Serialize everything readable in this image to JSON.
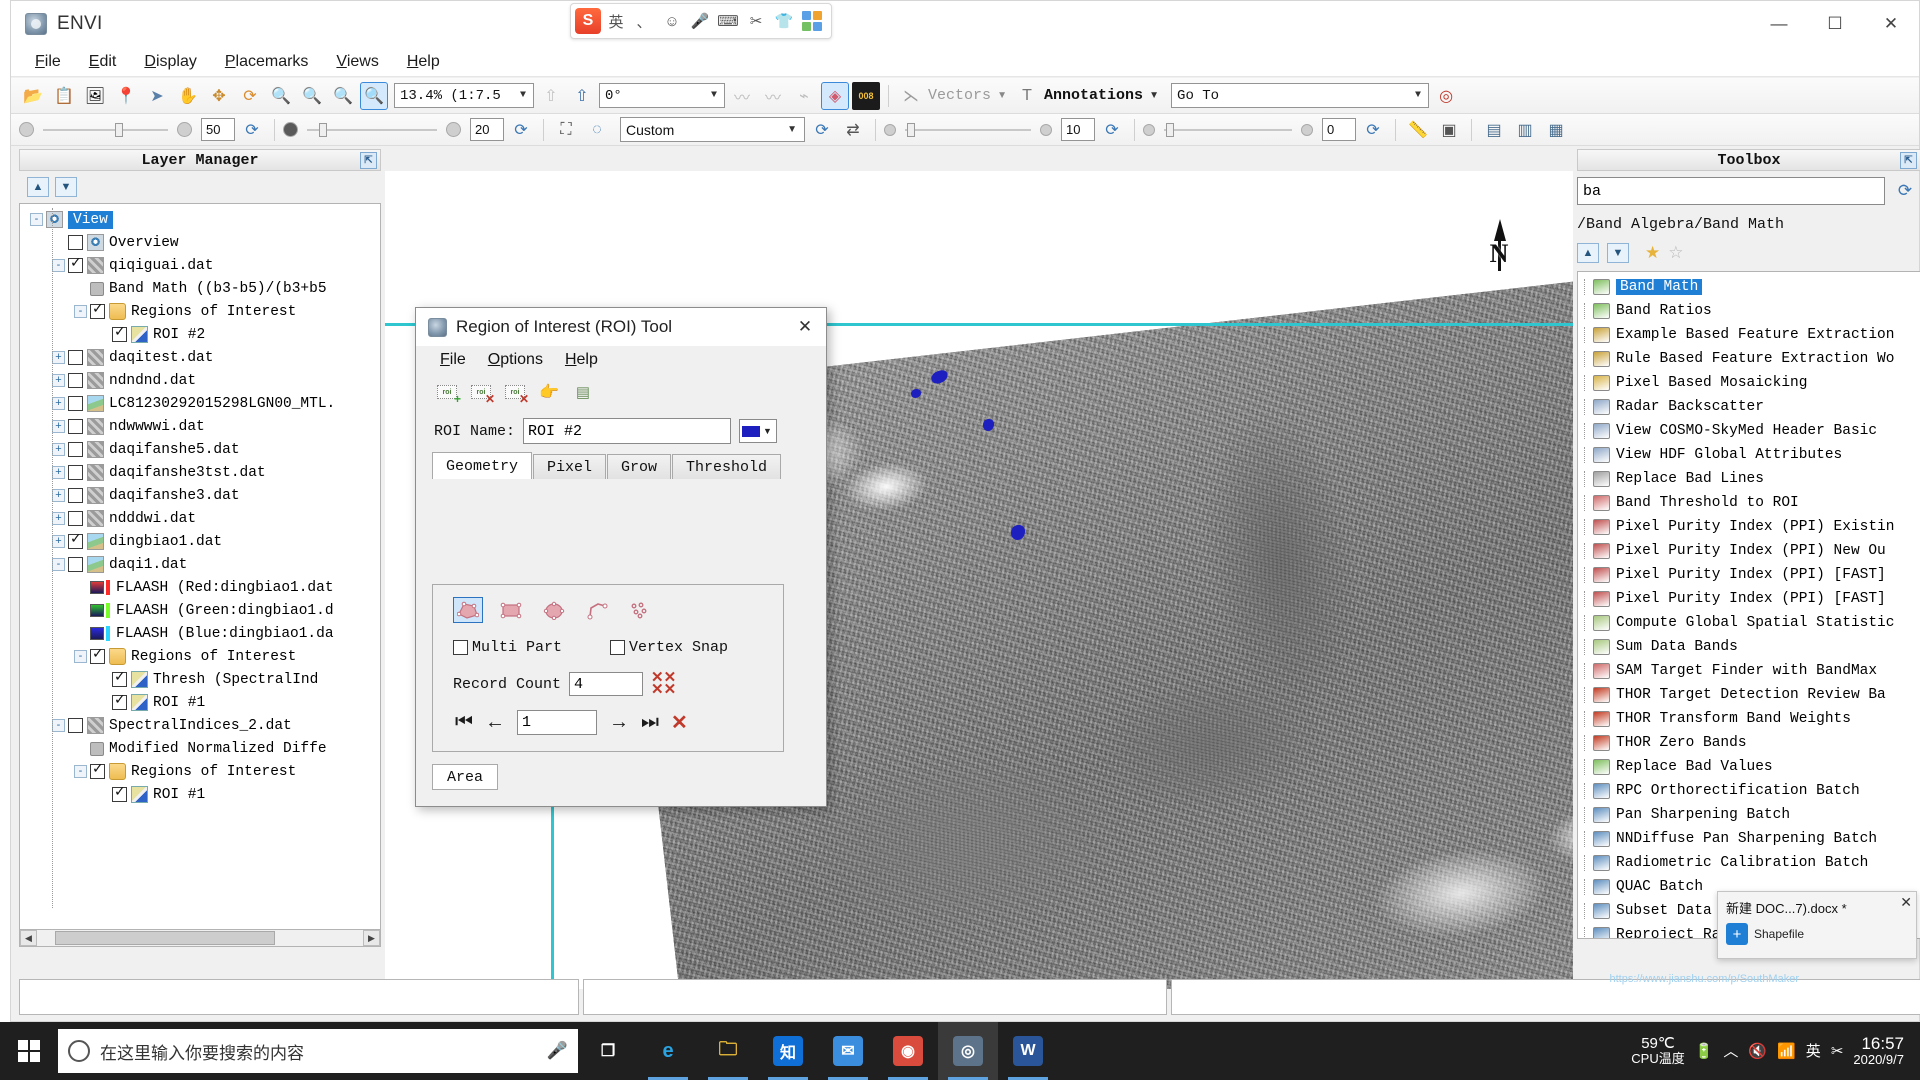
{
  "app": {
    "title": "ENVI",
    "icon": "envi-logo-icon",
    "window_controls": {
      "minimize": "—",
      "maximize": "☐",
      "close": "✕"
    }
  },
  "ime": {
    "logo": "S",
    "lang": "英",
    "items": [
      "、",
      "☺",
      "🎤",
      "⌨",
      "✂",
      "👕"
    ]
  },
  "menubar": [
    {
      "label": "File",
      "mnemonic": "F"
    },
    {
      "label": "Edit",
      "mnemonic": "E"
    },
    {
      "label": "Display",
      "mnemonic": "D"
    },
    {
      "label": "Placemarks",
      "mnemonic": "P"
    },
    {
      "label": "Views",
      "mnemonic": "V"
    },
    {
      "label": "Help",
      "mnemonic": "H"
    }
  ],
  "toolbar1": {
    "buttons": [
      {
        "name": "open-file-icon",
        "glyph": "📂"
      },
      {
        "name": "clipboard-icon",
        "glyph": "📋"
      },
      {
        "name": "crop-image-icon",
        "glyph": "🖼"
      },
      {
        "name": "placemark-pin-icon",
        "glyph": "📍"
      },
      {
        "name": "select-arrow-icon",
        "glyph": "➤"
      },
      {
        "name": "pan-hand-icon",
        "glyph": "✋"
      },
      {
        "name": "fit-to-window-icon",
        "glyph": "✥"
      },
      {
        "name": "rotate-icon",
        "glyph": "⟳"
      },
      {
        "name": "zoom-to-extent-icon",
        "glyph": "🔍"
      },
      {
        "name": "zoom-in-icon",
        "glyph": "🔍"
      },
      {
        "name": "zoom-out-icon",
        "glyph": "🔍"
      },
      {
        "name": "zoom-select-icon",
        "glyph": "🔍"
      }
    ],
    "zoom_value": "13.4% (1:7.5",
    "rotation_value": "0°",
    "go_to_placeholder": "Go To",
    "vectors_label": "Vectors",
    "annotations_label": "Annotations",
    "crosshair_label": "crosshair-icon",
    "roi_tool_label": "roi-tool-icon",
    "pixel_locator_label": "008"
  },
  "toolbar2": {
    "brightness_value": "50",
    "contrast_value": "20",
    "stretch_value": "Custom",
    "sharpen_value": "10",
    "transparency_value": "0"
  },
  "layer_manager": {
    "title": "Layer Manager",
    "pin": "⇱",
    "move_up": "▲",
    "move_down": "▼",
    "tree": [
      {
        "indent": 0,
        "expander": "-",
        "check": null,
        "icon": "eye",
        "label": "View",
        "selected": true
      },
      {
        "indent": 1,
        "expander": "",
        "check": false,
        "icon": "eye",
        "label": "Overview"
      },
      {
        "indent": 1,
        "expander": "-",
        "check": true,
        "icon": "raster",
        "label": "qiqiguai.dat"
      },
      {
        "indent": 2,
        "expander": "",
        "check": null,
        "icon": "band",
        "label": "Band Math ((b3-b5)/(b3+b5"
      },
      {
        "indent": 2,
        "expander": "-",
        "check": true,
        "icon": "folder",
        "label": "Regions of Interest"
      },
      {
        "indent": 3,
        "expander": "",
        "check": true,
        "icon": "roi",
        "label": "ROI #2"
      },
      {
        "indent": 1,
        "expander": "+",
        "check": false,
        "icon": "raster",
        "label": "daqitest.dat"
      },
      {
        "indent": 1,
        "expander": "+",
        "check": false,
        "icon": "raster",
        "label": "ndndnd.dat"
      },
      {
        "indent": 1,
        "expander": "+",
        "check": false,
        "icon": "rgb",
        "label": "LC81230292015298LGN00_MTL."
      },
      {
        "indent": 1,
        "expander": "+",
        "check": false,
        "icon": "raster",
        "label": "ndwwwwi.dat"
      },
      {
        "indent": 1,
        "expander": "+",
        "check": false,
        "icon": "raster",
        "label": "daqifanshe5.dat"
      },
      {
        "indent": 1,
        "expander": "+",
        "check": false,
        "icon": "raster",
        "label": "daqifanshe3tst.dat"
      },
      {
        "indent": 1,
        "expander": "+",
        "check": false,
        "icon": "raster",
        "label": "daqifanshe3.dat"
      },
      {
        "indent": 1,
        "expander": "+",
        "check": false,
        "icon": "raster",
        "label": "ndddwi.dat"
      },
      {
        "indent": 1,
        "expander": "+",
        "check": true,
        "icon": "rgb",
        "label": "dingbiao1.dat"
      },
      {
        "indent": 1,
        "expander": "-",
        "check": false,
        "icon": "rgb",
        "label": "daqi1.dat"
      },
      {
        "indent": 2,
        "expander": "",
        "check": null,
        "icon": "swatch-red",
        "label": "FLAASH (Red:dingbiao1.dat"
      },
      {
        "indent": 2,
        "expander": "",
        "check": null,
        "icon": "swatch-green",
        "label": "FLAASH (Green:dingbiao1.d"
      },
      {
        "indent": 2,
        "expander": "",
        "check": null,
        "icon": "swatch-blue",
        "label": "FLAASH (Blue:dingbiao1.da"
      },
      {
        "indent": 2,
        "expander": "-",
        "check": true,
        "icon": "folder",
        "label": "Regions of Interest"
      },
      {
        "indent": 3,
        "expander": "",
        "check": true,
        "icon": "roi",
        "label": "Thresh (SpectralInd"
      },
      {
        "indent": 3,
        "expander": "",
        "check": true,
        "icon": "roi",
        "label": "ROI #1"
      },
      {
        "indent": 1,
        "expander": "-",
        "check": false,
        "icon": "raster",
        "label": "SpectralIndices_2.dat"
      },
      {
        "indent": 2,
        "expander": "",
        "check": null,
        "icon": "band",
        "label": "Modified Normalized Diffe"
      },
      {
        "indent": 2,
        "expander": "-",
        "check": true,
        "icon": "folder",
        "label": "Regions of Interest"
      },
      {
        "indent": 3,
        "expander": "",
        "check": true,
        "icon": "roi",
        "label": "ROI #1"
      }
    ]
  },
  "roi_dialog": {
    "title": "Region of Interest (ROI) Tool",
    "icon": "envi-logo-icon",
    "close": "✕",
    "menus": [
      {
        "label": "File",
        "mnemonic": "F"
      },
      {
        "label": "Options",
        "mnemonic": "O"
      },
      {
        "label": "Help",
        "mnemonic": "H"
      }
    ],
    "toolbar": [
      {
        "name": "new-roi-icon",
        "badge": "+",
        "badge_color": "#2fa62f"
      },
      {
        "name": "delete-roi-icon",
        "badge": "✕",
        "badge_color": "#c0392b"
      },
      {
        "name": "delete-all-roi-icon",
        "badge": "✕",
        "badge_color": "#c0392b"
      },
      {
        "name": "select-roi-hand-icon",
        "badge": "",
        "badge_color": ""
      },
      {
        "name": "roi-statistics-icon",
        "badge": "",
        "badge_color": ""
      }
    ],
    "roi_name_label": "ROI Name:",
    "roi_name_value": "ROI #2",
    "roi_color": "#1d1fbf",
    "tabs": [
      {
        "label": "Geometry",
        "active": true
      },
      {
        "label": "Pixel",
        "active": false
      },
      {
        "label": "Grow",
        "active": false
      },
      {
        "label": "Threshold",
        "active": false
      }
    ],
    "geometry_tools": [
      {
        "name": "polygon-roi-icon",
        "selected": true
      },
      {
        "name": "rectangle-roi-icon",
        "selected": false
      },
      {
        "name": "ellipse-roi-icon",
        "selected": false
      },
      {
        "name": "polyline-roi-icon",
        "selected": false
      },
      {
        "name": "point-roi-icon",
        "selected": false
      }
    ],
    "multi_part_label": "Multi Part",
    "multi_part_checked": false,
    "vertex_snap_label": "Vertex Snap",
    "vertex_snap_checked": false,
    "record_count_label": "Record Count",
    "record_count_value": "4",
    "delete-record-icon": "✂",
    "nav": {
      "first": "⏮",
      "prev": "←",
      "value": "1",
      "next": "→",
      "last": "⏭",
      "delete": "✕"
    },
    "area_tab": "Area"
  },
  "toolbox": {
    "title": "Toolbox",
    "pin": "⇱",
    "search_value": "ba",
    "refresh": "⟳",
    "path": "/Band Algebra/Band Math",
    "nav_up": "▲",
    "nav_down": "▼",
    "star_filled": "★",
    "star_empty": "☆",
    "items": [
      {
        "label": "Band Math",
        "selected": true,
        "icon": "#7fbf5f"
      },
      {
        "label": "Band Ratios",
        "selected": false,
        "icon": "#7fbf5f"
      },
      {
        "label": "Example Based Feature Extraction",
        "selected": false,
        "icon": "#c9a23a"
      },
      {
        "label": "Rule Based Feature Extraction Wo",
        "selected": false,
        "icon": "#c9a23a"
      },
      {
        "label": "Pixel Based Mosaicking",
        "selected": false,
        "icon": "#d8b44a"
      },
      {
        "label": "Radar Backscatter",
        "selected": false,
        "icon": "#8fa8c8"
      },
      {
        "label": "View COSMO-SkyMed Header Basic",
        "selected": false,
        "icon": "#8fa8c8"
      },
      {
        "label": "View HDF Global Attributes",
        "selected": false,
        "icon": "#8fa8c8"
      },
      {
        "label": "Replace Bad Lines",
        "selected": false,
        "icon": "#a0a0a0"
      },
      {
        "label": "Band Threshold to ROI",
        "selected": false,
        "icon": "#d06a6a"
      },
      {
        "label": "Pixel Purity Index (PPI) Existin",
        "selected": false,
        "icon": "#c05050"
      },
      {
        "label": "Pixel Purity Index (PPI) New Ou",
        "selected": false,
        "icon": "#c05050"
      },
      {
        "label": "Pixel Purity Index (PPI) [FAST]",
        "selected": false,
        "icon": "#c05050"
      },
      {
        "label": "Pixel Purity Index (PPI) [FAST]",
        "selected": false,
        "icon": "#c05050"
      },
      {
        "label": "Compute Global Spatial Statistic",
        "selected": false,
        "icon": "#a8c87f"
      },
      {
        "label": "Sum Data Bands",
        "selected": false,
        "icon": "#a8c87f"
      },
      {
        "label": "SAM Target Finder with BandMax",
        "selected": false,
        "icon": "#d06a6a"
      },
      {
        "label": "THOR Target Detection Review Ba",
        "selected": false,
        "icon": "#c23b22"
      },
      {
        "label": "THOR Transform Band Weights",
        "selected": false,
        "icon": "#c23b22"
      },
      {
        "label": "THOR Zero Bands",
        "selected": false,
        "icon": "#c23b22"
      },
      {
        "label": "Replace Bad Values",
        "selected": false,
        "icon": "#7fbf5f"
      },
      {
        "label": "RPC Orthorectification Batch",
        "selected": false,
        "icon": "#5f8fbf"
      },
      {
        "label": "Pan Sharpening Batch",
        "selected": false,
        "icon": "#5f8fbf"
      },
      {
        "label": "NNDiffuse Pan Sharpening Batch",
        "selected": false,
        "icon": "#5f8fbf"
      },
      {
        "label": "Radiometric Calibration Batch",
        "selected": false,
        "icon": "#5f8fbf"
      },
      {
        "label": "QUAC Batch",
        "selected": false,
        "icon": "#5f8fbf"
      },
      {
        "label": "Subset Data from ROIs Batch",
        "selected": false,
        "icon": "#5f8fbf"
      },
      {
        "label": "Reproject Raster Batch",
        "selected": false,
        "icon": "#5f8fbf"
      }
    ]
  },
  "toast": {
    "filename": "新建 DOC...7).docx *",
    "action_label": "Shapefile",
    "close": "✕"
  },
  "taskbar": {
    "search_placeholder": "在这里输入你要搜索的内容",
    "mic_icon": "🎤",
    "items": [
      {
        "name": "task-view-icon",
        "glyph": "❐",
        "color": "#ffffff",
        "bg": "transparent",
        "open": false
      },
      {
        "name": "edge-icon",
        "glyph": "e",
        "color": "#2aa3e0",
        "bg": "transparent",
        "open": true
      },
      {
        "name": "file-explorer-icon",
        "glyph": "🗀",
        "color": "#f0c03a",
        "bg": "transparent",
        "open": true
      },
      {
        "name": "zhihu-icon",
        "glyph": "知",
        "color": "#ffffff",
        "bg": "#0f6fd6",
        "open": true
      },
      {
        "name": "foxmail-icon",
        "glyph": "✉",
        "color": "#ffffff",
        "bg": "#3b8ede",
        "open": true
      },
      {
        "name": "chrome-icon",
        "glyph": "◉",
        "color": "#ffffff",
        "bg": "#d94b3c",
        "open": true
      },
      {
        "name": "envi-icon",
        "glyph": "◎",
        "color": "#ffffff",
        "bg": "#5d7389",
        "open": true,
        "active": true
      },
      {
        "name": "word-icon",
        "glyph": "W",
        "color": "#ffffff",
        "bg": "#2a5699",
        "open": true
      }
    ],
    "tray": {
      "cpu_temp_value": "59℃",
      "cpu_temp_label": "CPU温度",
      "battery_icon": "🔋",
      "chevron_icon": "︿",
      "volume_icon": "🔇",
      "network_icon": "📶",
      "ime_icon": "英",
      "snip_icon": "✂"
    },
    "clock_time": "16:57",
    "clock_date": "2020/9/7"
  },
  "watermark": "https://www.jianshu.com/p/SouthMaker"
}
